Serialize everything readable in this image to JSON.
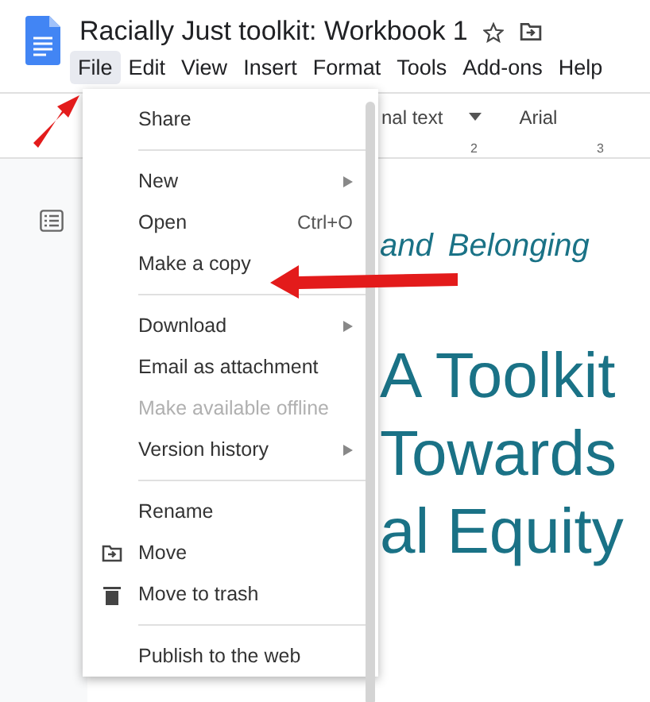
{
  "document": {
    "title": "Racially Just toolkit: Workbook 1",
    "starred": false
  },
  "menu_bar": [
    {
      "label": "File",
      "selected": true
    },
    {
      "label": "Edit",
      "selected": false
    },
    {
      "label": "View",
      "selected": false
    },
    {
      "label": "Insert",
      "selected": false
    },
    {
      "label": "Format",
      "selected": false
    },
    {
      "label": "Tools",
      "selected": false
    },
    {
      "label": "Add-ons",
      "selected": false
    },
    {
      "label": "Help",
      "selected": false
    }
  ],
  "toolbar": {
    "style": "nal text",
    "font": "Arial"
  },
  "ruler": {
    "marks": [
      "2",
      "3"
    ]
  },
  "file_menu": [
    {
      "kind": "item",
      "label": "Share",
      "disabled": false,
      "submenu": false
    },
    {
      "kind": "separator"
    },
    {
      "kind": "item",
      "label": "New",
      "disabled": false,
      "submenu": true
    },
    {
      "kind": "item",
      "label": "Open",
      "shortcut": "Ctrl+O",
      "disabled": false,
      "submenu": false
    },
    {
      "kind": "item",
      "label": "Make a copy",
      "disabled": false,
      "submenu": false
    },
    {
      "kind": "separator"
    },
    {
      "kind": "item",
      "label": "Download",
      "disabled": false,
      "submenu": true
    },
    {
      "kind": "item",
      "label": "Email as attachment",
      "disabled": false,
      "submenu": false
    },
    {
      "kind": "item",
      "label": "Make available offline",
      "disabled": true,
      "submenu": false
    },
    {
      "kind": "item",
      "label": "Version history",
      "disabled": false,
      "submenu": true
    },
    {
      "kind": "separator"
    },
    {
      "kind": "item",
      "label": "Rename",
      "disabled": false,
      "submenu": false
    },
    {
      "kind": "folder",
      "label": "Move",
      "disabled": false,
      "submenu": false
    },
    {
      "kind": "trash",
      "label": "Move to trash",
      "disabled": false,
      "submenu": false
    },
    {
      "kind": "separator"
    },
    {
      "kind": "item",
      "label": "Publish to the web",
      "disabled": false,
      "submenu": false
    }
  ],
  "page": {
    "subtitle": "and Belonging",
    "heading_lines": [
      "A Toolkit",
      "Towards",
      "al Equity"
    ]
  }
}
